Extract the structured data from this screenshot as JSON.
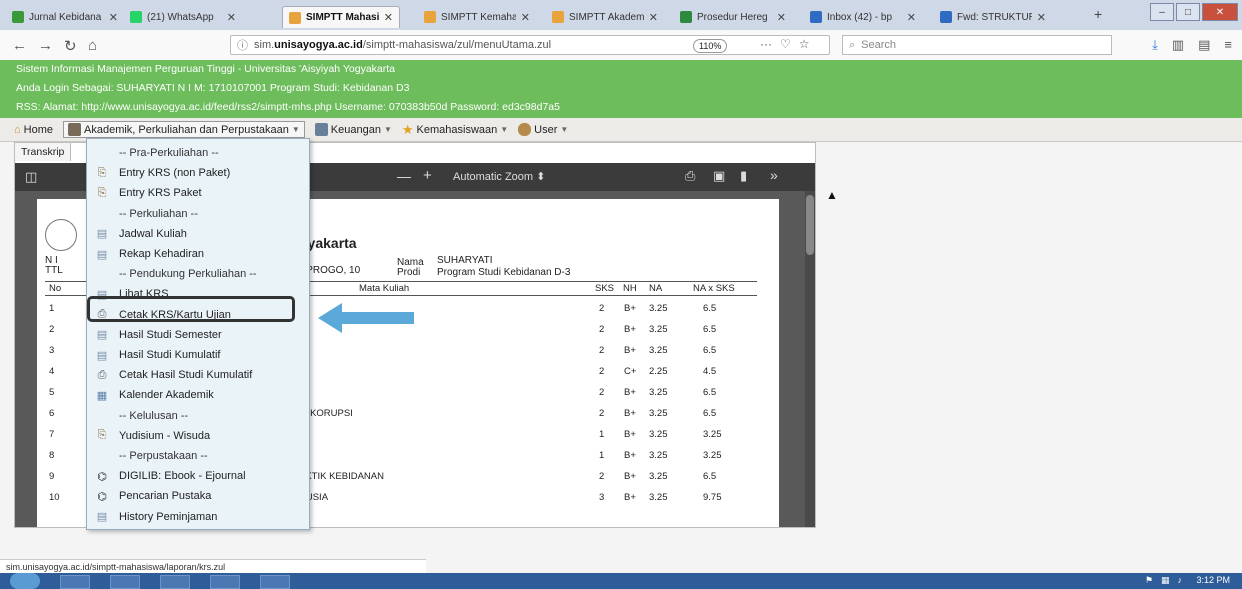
{
  "browser": {
    "tabs": [
      {
        "title": "Jurnal Kebidana",
        "icon_color": "#3a9a3a"
      },
      {
        "title": "(21) WhatsApp",
        "icon_color": "#25d366"
      },
      {
        "title": "SIMPTT Mahasi",
        "icon_color": "#e8a33d"
      },
      {
        "title": "SIMPTT Kemaha",
        "icon_color": "#e8a33d"
      },
      {
        "title": "SIMPTT Akadem",
        "icon_color": "#e8a33d"
      },
      {
        "title": "Prosedur Hereg",
        "icon_color": "#2b8a3e"
      },
      {
        "title": "Inbox (42) - bp",
        "icon_color": "#2f6bc2"
      },
      {
        "title": "Fwd: STRUKTUR",
        "icon_color": "#2f6bc2"
      }
    ],
    "close_glyph": "✕",
    "new_tab": "+",
    "url_prefix": "sim.",
    "url_domain": "unisayogya.ac.id",
    "url_path": "/simptt-mahasiswa/zul/menuUtama.zul",
    "zoom": "110%",
    "url_more": "···",
    "search_placeholder": "Search"
  },
  "header": {
    "line1": "Sistem Informasi Manajemen Perguruan Tinggi - Universitas 'Aisyiyah Yogyakarta",
    "line2": "Anda Login Sebagai: SUHARYATI    N I M: 1710107001    Program Studi: Kebidanan D3",
    "line3": "RSS:    Alamat: http://www.unisayogya.ac.id/feed/rss2/simptt-mhs.php    Username: 070383b50d    Password: ed3c98d7a5"
  },
  "menubar": {
    "home": "Home",
    "akademik": "Akademik, Perkuliahan dan Perpustakaan",
    "keuangan": "Keuangan",
    "kemahasiswaan": "Kemahasiswaan",
    "user": "User"
  },
  "panel": {
    "tab_label": "Transkrip",
    "pdf_zoom": "Automatic Zoom",
    "page": {
      "title": "gyakarta",
      "nim_label": "N I",
      "ttl_label": "TTL",
      "ttl_value": "NPROGO, 10",
      "nama_label": "Nama",
      "nama_value": "SUHARYATI",
      "prodi_label": "Prodi",
      "prodi_value": "Program Studi Kebidanan D-3",
      "col_no": "No",
      "col_mk": "Mata Kuliah",
      "col_sks": "SKS",
      "col_nh": "NH",
      "col_na": "NA",
      "col_naxsks": "NA x SKS",
      "rows": [
        {
          "no": "1",
          "mk": "",
          "sks": "2",
          "nh": "B+",
          "na": "3.25",
          "naxsks": "6.5"
        },
        {
          "no": "2",
          "mk": "",
          "sks": "2",
          "nh": "B+",
          "na": "3.25",
          "naxsks": "6.5"
        },
        {
          "no": "3",
          "mk": "",
          "sks": "2",
          "nh": "B+",
          "na": "3.25",
          "naxsks": "6.5"
        },
        {
          "no": "4",
          "mk": "",
          "sks": "2",
          "nh": "C+",
          "na": "2.25",
          "naxsks": "4.5"
        },
        {
          "no": "5",
          "mk": "",
          "sks": "2",
          "nh": "B+",
          "na": "3.25",
          "naxsks": "6.5"
        },
        {
          "no": "6",
          "mk": "TI KORUPSI",
          "sks": "2",
          "nh": "B+",
          "na": "3.25",
          "naxsks": "6.5"
        },
        {
          "no": "7",
          "mk": "",
          "sks": "1",
          "nh": "B+",
          "na": "3.25",
          "naxsks": "3.25"
        },
        {
          "no": "8",
          "mk": "",
          "sks": "1",
          "nh": "B+",
          "na": "3.25",
          "naxsks": "3.25"
        },
        {
          "no": "9",
          "mk": "AKTIK KEBIDANAN",
          "sks": "2",
          "nh": "B+",
          "na": "3.25",
          "naxsks": "6.5"
        },
        {
          "no": "10",
          "mk": "NUSIA",
          "sks": "3",
          "nh": "B+",
          "na": "3.25",
          "naxsks": "9.75"
        }
      ]
    }
  },
  "dropdown": [
    {
      "label": "-- Pra-Perkuliahan --",
      "type": "head",
      "icon": ""
    },
    {
      "label": "Entry KRS (non Paket)",
      "type": "item",
      "icon": "scroll-icon"
    },
    {
      "label": "Entry KRS Paket",
      "type": "item",
      "icon": "scroll-icon"
    },
    {
      "label": "-- Perkuliahan --",
      "type": "head",
      "icon": ""
    },
    {
      "label": "Jadwal Kuliah",
      "type": "item",
      "icon": "document-icon"
    },
    {
      "label": "Rekap Kehadiran",
      "type": "item",
      "icon": "document-icon"
    },
    {
      "label": "-- Pendukung Perkuliahan --",
      "type": "head",
      "icon": ""
    },
    {
      "label": "Lihat KRS",
      "type": "item",
      "icon": "document-icon"
    },
    {
      "label": "Cetak KRS/Kartu Ujian",
      "type": "item",
      "icon": "printer-icon"
    },
    {
      "label": "Hasil Studi Semester",
      "type": "item",
      "icon": "document-icon"
    },
    {
      "label": "Hasil Studi Kumulatif",
      "type": "item",
      "icon": "document-icon"
    },
    {
      "label": "Cetak Hasil Studi Kumulatif",
      "type": "item",
      "icon": "printer-icon"
    },
    {
      "label": "Kalender Akademik",
      "type": "item",
      "icon": "calendar-icon"
    },
    {
      "label": "-- Kelulusan --",
      "type": "head",
      "icon": ""
    },
    {
      "label": "Yudisium - Wisuda",
      "type": "item",
      "icon": "scroll-icon"
    },
    {
      "label": "-- Perpustakaan --",
      "type": "head",
      "icon": ""
    },
    {
      "label": "DIGILIB: Ebook - Ejournal",
      "type": "item",
      "icon": "binoculars-icon"
    },
    {
      "label": "Pencarian Pustaka",
      "type": "item",
      "icon": "binoculars-icon"
    },
    {
      "label": "History Peminjaman",
      "type": "item",
      "icon": "document-icon"
    }
  ],
  "status_url": "sim.unisayogya.ac.id/simptt-mahasiswa/laporan/krs.zul",
  "clock": "3:12 PM",
  "colors": {
    "header_green": "#6ebd5c",
    "arrow_blue": "#5aa9d9",
    "dropdown_bg": "#eaf3f8"
  }
}
